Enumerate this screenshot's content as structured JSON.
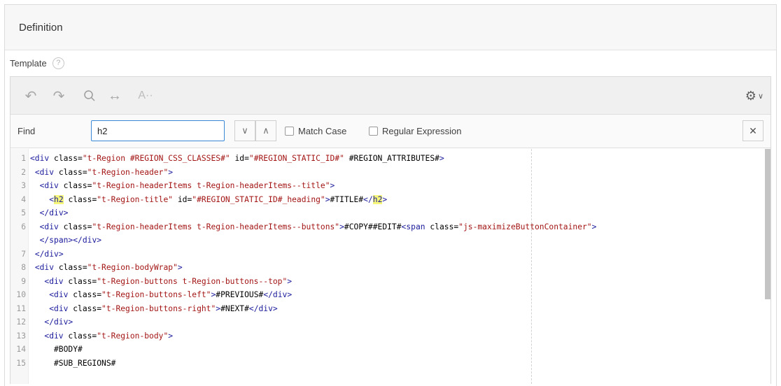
{
  "region": {
    "title": "Definition"
  },
  "field": {
    "label": "Template",
    "help": "?"
  },
  "toolbar": {
    "undo_glyph": "↶",
    "redo_glyph": "↷",
    "search_glyph": "⚲",
    "replace_glyph": "↔",
    "autocomplete_glyph": "A··",
    "settings_glyph": "⚙",
    "settings_caret": "∨"
  },
  "find": {
    "label": "Find",
    "value": "h2",
    "next_glyph": "∨",
    "prev_glyph": "∧",
    "match_case_label": "Match Case",
    "regex_label": "Regular Expression",
    "close_glyph": "✕"
  },
  "code": {
    "lines": [
      {
        "n": "1",
        "text": "<div class=\"t-Region #REGION_CSS_CLASSES#\" id=\"#REGION_STATIC_ID#\" #REGION_ATTRIBUTES#>"
      },
      {
        "n": "2",
        "text": " <div class=\"t-Region-header\">"
      },
      {
        "n": "3",
        "text": "  <div class=\"t-Region-headerItems t-Region-headerItems--title\">"
      },
      {
        "n": "4",
        "text": "    <h2 class=\"t-Region-title\" id=\"#REGION_STATIC_ID#_heading\">#TITLE#</h2>"
      },
      {
        "n": "5",
        "text": "  </div>"
      },
      {
        "n": "6",
        "text": "  <div class=\"t-Region-headerItems t-Region-headerItems--buttons\">#COPY##EDIT#<span class=\"js-maximizeButtonContainer\">"
      },
      {
        "n": "",
        "text": "  </span></div>"
      },
      {
        "n": "7",
        "text": " </div>"
      },
      {
        "n": "8",
        "text": " <div class=\"t-Region-bodyWrap\">"
      },
      {
        "n": "9",
        "text": "   <div class=\"t-Region-buttons t-Region-buttons--top\">"
      },
      {
        "n": "10",
        "text": "    <div class=\"t-Region-buttons-left\">#PREVIOUS#</div>"
      },
      {
        "n": "11",
        "text": "    <div class=\"t-Region-buttons-right\">#NEXT#</div>"
      },
      {
        "n": "12",
        "text": "   </div>"
      },
      {
        "n": "13",
        "text": "   <div class=\"t-Region-body\">"
      },
      {
        "n": "14",
        "text": "     #BODY#"
      },
      {
        "n": "15",
        "text": "     #SUB_REGIONS#"
      }
    ]
  },
  "colors": {
    "accent": "#3a87d6",
    "match_highlight": "#f6f67a",
    "tag": "#1a1a9c",
    "string": "#a31515"
  }
}
